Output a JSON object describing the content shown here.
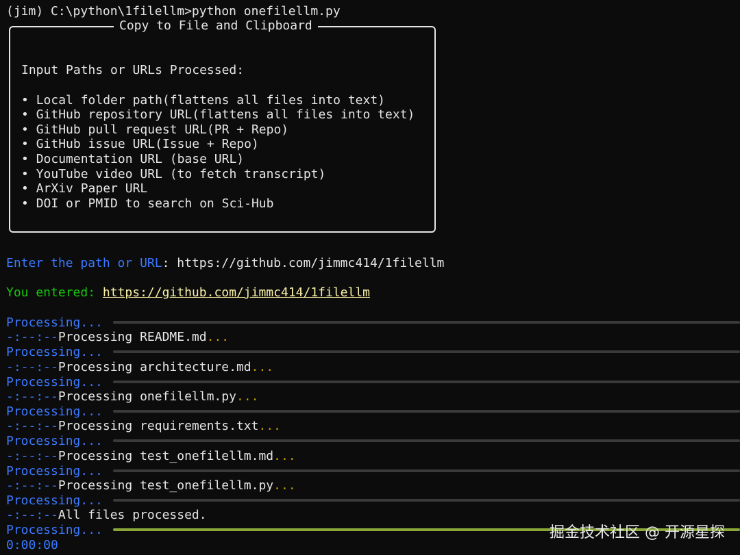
{
  "prompt": "(jim) C:\\python\\1filellm>python onefilellm.py",
  "panel": {
    "title": "Copy to File and Clipboard",
    "heading": "Input Paths or URLs Processed:",
    "bullet": "•",
    "items": [
      "Local folder path(flattens all files into text)",
      "GitHub repository URL(flattens all files into text)",
      "GitHub pull request URL(PR + Repo)",
      "GitHub issue URL(Issue + Repo)",
      "Documentation URL (base URL)",
      "YouTube video URL (to fetch transcript)",
      "ArXiv Paper URL",
      "DOI or PMID to search on Sci-Hub"
    ]
  },
  "input": {
    "prompt_label": "Enter the path or URL",
    "separator": ":",
    "value": "https://github.com/jimmc414/1filellm"
  },
  "confirm": {
    "label": "You entered:",
    "value": "https://github.com/jimmc414/1filellm"
  },
  "processing": {
    "label": "Processing...",
    "time_prefix": "-:--:--",
    "steps": [
      {
        "text": "Processing README.md",
        "dots": "..."
      },
      {
        "text": "Processing architecture.md",
        "dots": "..."
      },
      {
        "text": "Processing onefilellm.py",
        "dots": "..."
      },
      {
        "text": "Processing requirements.txt",
        "dots": "..."
      },
      {
        "text": "Processing test_onefilellm.md",
        "dots": "..."
      },
      {
        "text": "Processing test_onefilellm.py",
        "dots": "..."
      },
      {
        "text": "All files processed.",
        "dots": ""
      }
    ],
    "final_elapsed": "0:00:00",
    "final_progress": 1.0
  },
  "watermark": "掘金技术社区 @ 开源星探",
  "colors": {
    "background": "#0c0c0c",
    "blue": "#3b78ff",
    "green": "#16c60c",
    "yellow": "#c19c00",
    "bar_complete": "#8aa83a"
  }
}
